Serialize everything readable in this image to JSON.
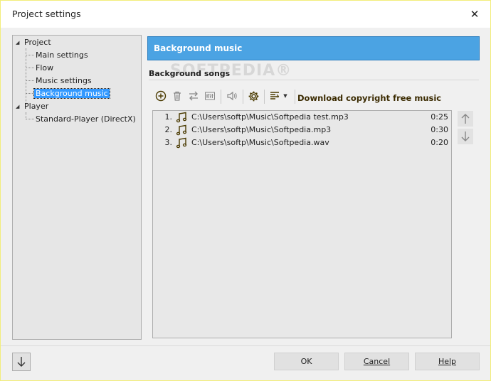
{
  "window": {
    "title": "Project settings",
    "close_glyph": "✕"
  },
  "tree": {
    "root_project": "Project",
    "project_children": [
      "Main settings",
      "Flow",
      "Music settings",
      "Background music"
    ],
    "selected": "Background music",
    "root_player": "Player",
    "player_children": [
      "Standard-Player (DirectX)"
    ]
  },
  "panel": {
    "header": "Background music",
    "sub_heading": "Background songs",
    "watermark": "SOFTPEDIA®"
  },
  "toolbar": {
    "icons": [
      "add-icon",
      "delete-icon",
      "swap-icon",
      "equalizer-icon",
      "volume-icon",
      "settings-gear-icon",
      "list-options-icon"
    ],
    "download_link": "Download copyright free music"
  },
  "songs": [
    {
      "num": "1.",
      "path": "C:\\Users\\softp\\Music\\Softpedia test.mp3",
      "duration": "0:25"
    },
    {
      "num": "2.",
      "path": "C:\\Users\\softp\\Music\\Softpedia.mp3",
      "duration": "0:30"
    },
    {
      "num": "3.",
      "path": "C:\\Users\\softp\\Music\\Softpedia.wav",
      "duration": "0:20"
    }
  ],
  "buttons": {
    "ok": "OK",
    "cancel": "Cancel",
    "help": "Help"
  },
  "colors": {
    "header_bg": "#4ba3e3",
    "selection": "#3399ff",
    "window_bg": "#f0f0f0"
  }
}
